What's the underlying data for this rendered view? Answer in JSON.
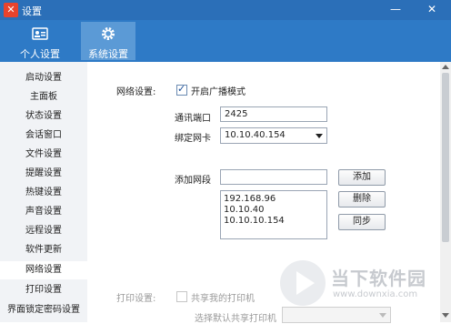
{
  "window": {
    "title": "设置",
    "min_glyph": "—",
    "close_glyph": "✕"
  },
  "top_tabs": [
    {
      "label": "个人设置",
      "icon": "id-card-icon",
      "selected": false
    },
    {
      "label": "系统设置",
      "icon": "gear-icon",
      "selected": true
    }
  ],
  "sidebar": {
    "items": [
      {
        "label": "启动设置"
      },
      {
        "label": "主面板"
      },
      {
        "label": "状态设置"
      },
      {
        "label": "会话窗口"
      },
      {
        "label": "文件设置"
      },
      {
        "label": "提醒设置"
      },
      {
        "label": "热键设置"
      },
      {
        "label": "声音设置"
      },
      {
        "label": "远程设置"
      },
      {
        "label": "软件更新"
      },
      {
        "label": "网络设置"
      },
      {
        "label": "打印设置"
      },
      {
        "label": "界面锁定密码设置"
      }
    ],
    "active_index": 10
  },
  "network": {
    "section_label": "网络设置:",
    "broadcast_label": "开启广播模式",
    "broadcast_checked": true,
    "port_label": "通讯端口",
    "port_value": "2425",
    "nic_label": "绑定网卡",
    "nic_value": "10.10.40.154",
    "add_segment_label": "添加网段",
    "add_segment_value": "",
    "add_button": "添加",
    "delete_button": "删除",
    "sync_button": "同步",
    "segments": [
      "192.168.96",
      "10.10.40",
      "10.10.10.154"
    ]
  },
  "print": {
    "section_label": "打印设置:",
    "share_label": "共享我的打印机",
    "share_checked": false,
    "default_printer_label": "选择默认共享打印机",
    "default_printer_value": ""
  },
  "watermark": {
    "brand": "当下软件园",
    "url": "www.downxia.com"
  },
  "colors": {
    "titlebar": "#2b6fb8",
    "topbar": "#2e7ac6",
    "selected_tab": "#5b9ad6",
    "sidebar_bg": "#f1f3f6"
  }
}
